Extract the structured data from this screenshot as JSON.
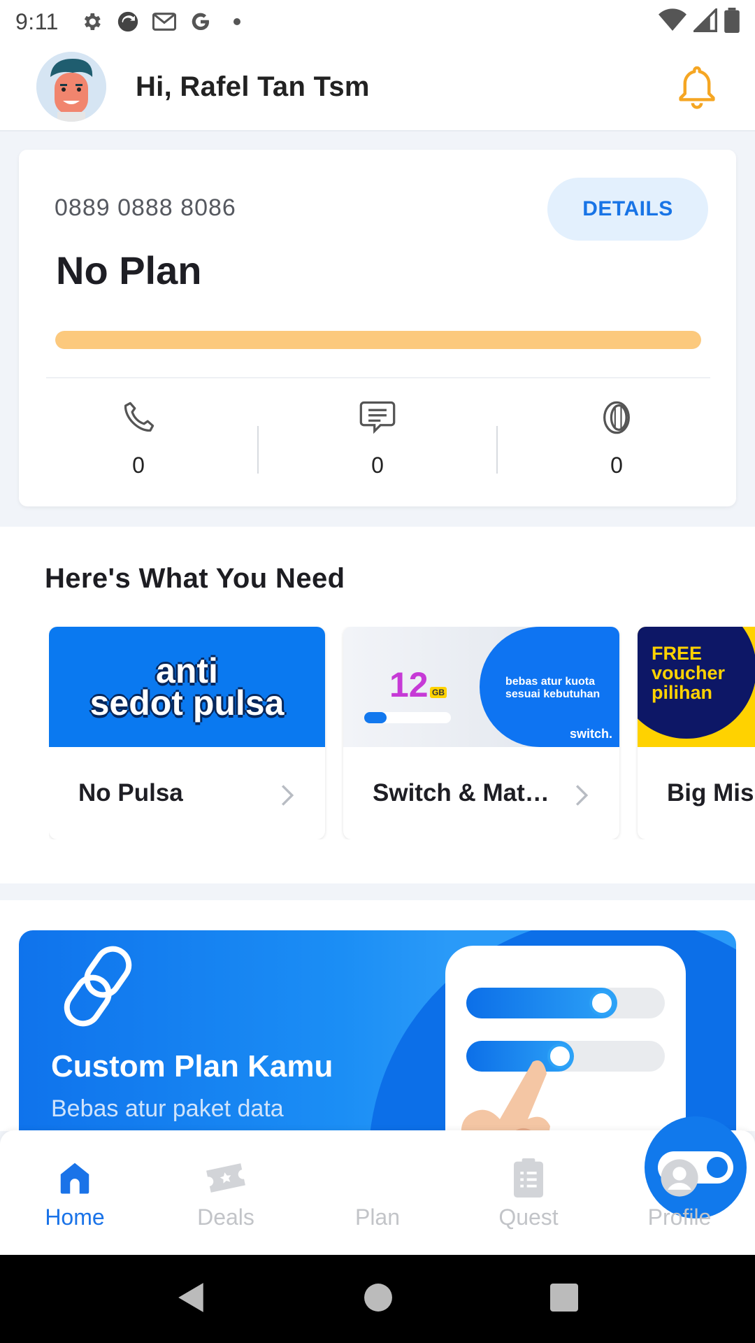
{
  "status_bar": {
    "time": "9:11"
  },
  "header": {
    "greeting": "Hi, Rafel Tan Tsm"
  },
  "plan": {
    "phone_number": "0889 0888 8086",
    "details_label": "DETAILS",
    "plan_name": "No Plan",
    "progress_fraction": 1.0,
    "progress_color": "#fcc97d",
    "stats": [
      {
        "icon": "phone-icon",
        "value": "0"
      },
      {
        "icon": "sms-icon",
        "value": "0"
      },
      {
        "icon": "coin-icon",
        "value": "0"
      }
    ]
  },
  "needs": {
    "title": "Here's What You Need",
    "cards": [
      {
        "label": "No Pulsa",
        "banner_text_line1": "anti",
        "banner_text_line2": "sedot pulsa"
      },
      {
        "label": "Switch & Mat…",
        "banner_num": "12",
        "banner_unit": "GB",
        "banner_text_line1": "bebas atur kuota",
        "banner_text_line2": "sesuai kebutuhan",
        "banner_brand": "switch."
      },
      {
        "label": "Big Mis",
        "banner_text_line1": "FREE",
        "banner_text_line2": "voucher",
        "banner_text_line3": "pilihan"
      }
    ]
  },
  "custom_plan": {
    "title": "Custom Plan Kamu",
    "subtitle": "Bebas atur paket data"
  },
  "bottom_nav": {
    "items": [
      {
        "label": "Home",
        "icon": "home-icon",
        "active": true
      },
      {
        "label": "Deals",
        "icon": "ticket-icon",
        "active": false
      },
      {
        "label": "Plan",
        "icon": "toggle-icon",
        "active": false
      },
      {
        "label": "Quest",
        "icon": "clipboard-icon",
        "active": false
      },
      {
        "label": "Profile",
        "icon": "user-icon",
        "active": false
      }
    ]
  },
  "colors": {
    "accent": "#1a73e8",
    "inactive": "#c2c4c8",
    "bell": "#f5a623"
  }
}
